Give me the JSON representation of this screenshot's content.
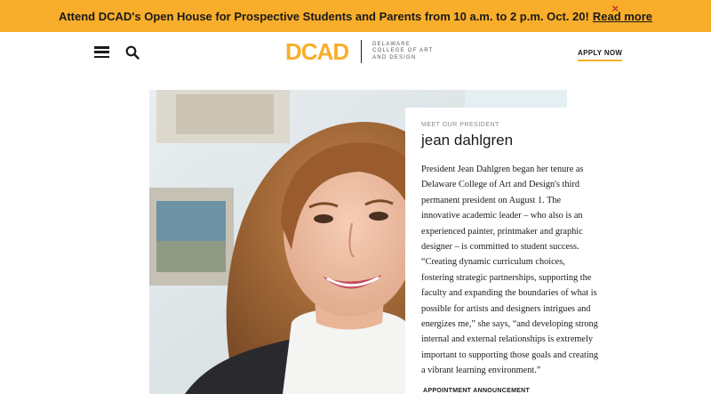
{
  "announcement": {
    "text": "Attend DCAD's Open House for Prospective Students and Parents from 10 a.m. to 2 p.m. Oct. 20!",
    "link": "Read more",
    "close_symbol": "×"
  },
  "header": {
    "menu_icon": "hamburger-menu-icon",
    "search_icon": "search-icon",
    "logo_mark": "DCAD",
    "logo_subtitle": [
      "DELAWARE",
      "COLLEGE OF ART",
      "AND DESIGN"
    ],
    "cta": "APPLY NOW"
  },
  "feature": {
    "eyebrow": "MEET OUR PRESIDENT",
    "name": "jean dahlgren",
    "bio": "President Jean Dahlgren began her tenure as Delaware College of Art and Design's third permanent president on August 1. The innovative academic leader – who also is an experienced painter, printmaker and graphic designer – is committed to student success. “Creating dynamic curriculum choices, fostering strategic partnerships, supporting the faculty and expanding the boundaries of what is possible for artists and designers intrigues and energizes me,” she says, “and developing strong internal and external relationships is extremely important to supporting those goals and creating a vibrant learning environment.”",
    "link": "APPOINTMENT ANNOUNCEMENT"
  },
  "colors": {
    "accent": "#f9ae2b",
    "close": "#c0392b",
    "text": "#1a1a1a"
  }
}
